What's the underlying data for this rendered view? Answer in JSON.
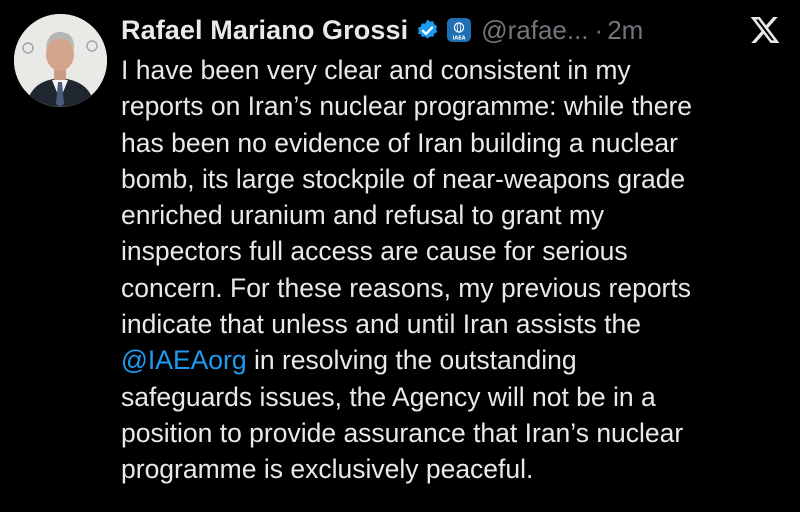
{
  "author": {
    "display_name": "Rafael Mariano Grossi",
    "handle": "@rafae...",
    "separator": "·",
    "time": "2m",
    "affiliate_badge_text": "IAEA"
  },
  "platform_icon": "x-logo-icon",
  "tweet": {
    "lines": [
      "I have been very clear and consistent in my",
      "reports on Iran’s nuclear programme: while there",
      "has been no evidence of Iran building a nuclear",
      "bomb, its large stockpile of near-weapons grade",
      "enriched uranium and refusal to grant my",
      "inspectors full access are cause for serious",
      "concern. For these reasons, my previous reports",
      "indicate that unless and until Iran assists the"
    ],
    "mention": "@IAEAorg",
    "mention_rest": " in resolving the outstanding",
    "lines_after": [
      "safeguards issues, the Agency will not be in a",
      "position to provide assurance that Iran’s nuclear",
      "programme is exclusively peaceful."
    ]
  },
  "colors": {
    "background": "#000000",
    "text": "#e7e9ea",
    "secondary": "#71767b",
    "link": "#1d9bf0",
    "verified": "#1d9bf0"
  }
}
